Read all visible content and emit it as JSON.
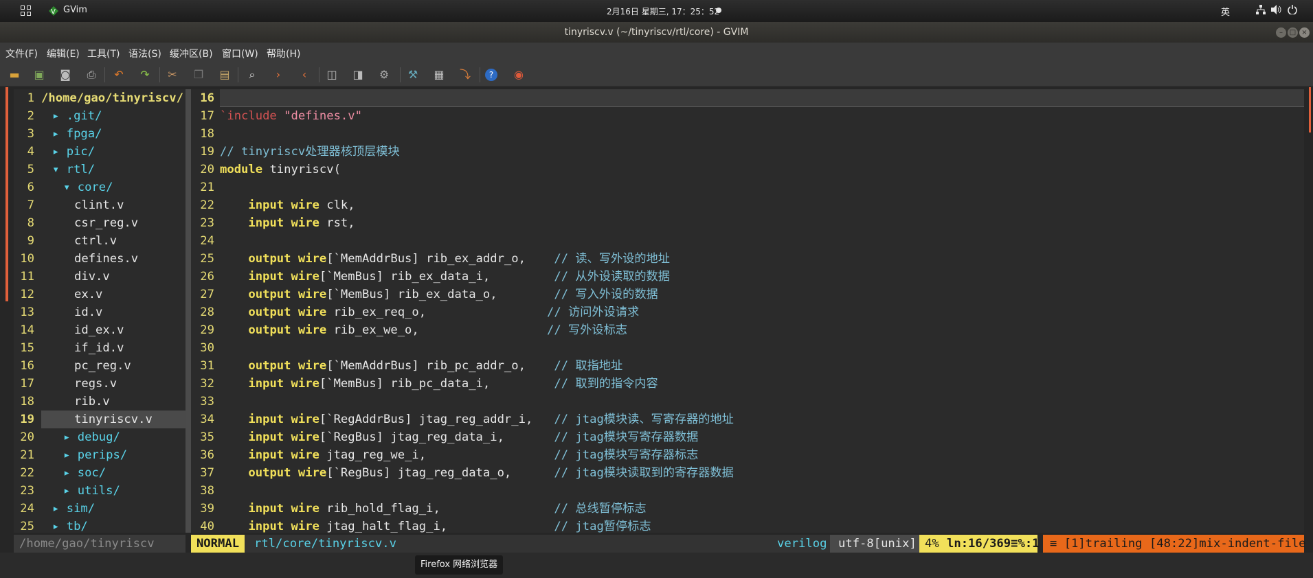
{
  "topbar": {
    "app_name": "GVim",
    "clock": "2月16日 星期三, 17：25：52",
    "ime": "英",
    "icons": [
      "network-icon",
      "volume-icon",
      "power-icon"
    ]
  },
  "window": {
    "title": "tinyriscv.v (~/tinyriscv/rtl/core) - GVIM"
  },
  "menu": [
    "文件(F)",
    "编辑(E)",
    "工具(T)",
    "语法(S)",
    "缓冲区(B)",
    "窗口(W)",
    "帮助(H)"
  ],
  "toolbar": [
    "open-icon",
    "save-session-icon",
    "save-icon",
    "print-icon",
    "undo-icon",
    "redo-icon",
    "cut-icon",
    "copy-icon",
    "paste-icon",
    "find-replace-icon",
    "find-next-icon",
    "find-prev-icon",
    "load-session-icon",
    "save-session-icon",
    "run-script-icon",
    "make-icon",
    "shell-icon",
    "tags-icon",
    "help-icon",
    "find-help-icon"
  ],
  "tree": {
    "current_line": 19,
    "rows": [
      {
        "n": "1",
        "text": "/home/gao/tinyriscv/",
        "kind": "root",
        "indent": 0,
        "arrow": ""
      },
      {
        "n": "2",
        "text": ".git/",
        "kind": "dir",
        "indent": 0,
        "arrow": "▸"
      },
      {
        "n": "3",
        "text": "fpga/",
        "kind": "dir",
        "indent": 0,
        "arrow": "▸"
      },
      {
        "n": "4",
        "text": "pic/",
        "kind": "dir",
        "indent": 0,
        "arrow": "▸"
      },
      {
        "n": "5",
        "text": "rtl/",
        "kind": "dir",
        "indent": 0,
        "arrow": "▾"
      },
      {
        "n": "6",
        "text": "core/",
        "kind": "dir",
        "indent": 1,
        "arrow": "▾"
      },
      {
        "n": "7",
        "text": "clint.v",
        "kind": "file",
        "indent": 2,
        "arrow": ""
      },
      {
        "n": "8",
        "text": "csr_reg.v",
        "kind": "file",
        "indent": 2,
        "arrow": ""
      },
      {
        "n": "9",
        "text": "ctrl.v",
        "kind": "file",
        "indent": 2,
        "arrow": ""
      },
      {
        "n": "10",
        "text": "defines.v",
        "kind": "file",
        "indent": 2,
        "arrow": ""
      },
      {
        "n": "11",
        "text": "div.v",
        "kind": "file",
        "indent": 2,
        "arrow": ""
      },
      {
        "n": "12",
        "text": "ex.v",
        "kind": "file",
        "indent": 2,
        "arrow": ""
      },
      {
        "n": "13",
        "text": "id.v",
        "kind": "file",
        "indent": 2,
        "arrow": ""
      },
      {
        "n": "14",
        "text": "id_ex.v",
        "kind": "file",
        "indent": 2,
        "arrow": ""
      },
      {
        "n": "15",
        "text": "if_id.v",
        "kind": "file",
        "indent": 2,
        "arrow": ""
      },
      {
        "n": "16",
        "text": "pc_reg.v",
        "kind": "file",
        "indent": 2,
        "arrow": ""
      },
      {
        "n": "17",
        "text": "regs.v",
        "kind": "file",
        "indent": 2,
        "arrow": ""
      },
      {
        "n": "18",
        "text": "rib.v",
        "kind": "file",
        "indent": 2,
        "arrow": ""
      },
      {
        "n": "19",
        "text": "tinyriscv.v",
        "kind": "file",
        "indent": 2,
        "arrow": ""
      },
      {
        "n": "20",
        "text": "debug/",
        "kind": "dir",
        "indent": 1,
        "arrow": "▸"
      },
      {
        "n": "21",
        "text": "perips/",
        "kind": "dir",
        "indent": 1,
        "arrow": "▸"
      },
      {
        "n": "22",
        "text": "soc/",
        "kind": "dir",
        "indent": 1,
        "arrow": "▸"
      },
      {
        "n": "23",
        "text": "utils/",
        "kind": "dir",
        "indent": 1,
        "arrow": "▸"
      },
      {
        "n": "24",
        "text": "sim/",
        "kind": "dir",
        "indent": 0,
        "arrow": "▸"
      },
      {
        "n": "25",
        "text": "tb/",
        "kind": "dir",
        "indent": 0,
        "arrow": "▸"
      }
    ]
  },
  "code": {
    "current_line": 16,
    "lines": [
      {
        "n": "16",
        "segs": []
      },
      {
        "n": "17",
        "segs": [
          [
            "dir",
            "`include "
          ],
          [
            "str",
            "\"defines.v\""
          ]
        ]
      },
      {
        "n": "18",
        "segs": []
      },
      {
        "n": "19",
        "segs": [
          [
            "cmt",
            "// tinyriscv处理器核顶层模块"
          ]
        ]
      },
      {
        "n": "20",
        "segs": [
          [
            "key",
            "module"
          ],
          [
            "plain",
            " tinyriscv("
          ]
        ]
      },
      {
        "n": "21",
        "segs": []
      },
      {
        "n": "22",
        "segs": [
          [
            "plain",
            "    "
          ],
          [
            "key",
            "input wire"
          ],
          [
            "plain",
            " clk,"
          ]
        ]
      },
      {
        "n": "23",
        "segs": [
          [
            "plain",
            "    "
          ],
          [
            "key",
            "input wire"
          ],
          [
            "plain",
            " rst,"
          ]
        ]
      },
      {
        "n": "24",
        "segs": []
      },
      {
        "n": "25",
        "segs": [
          [
            "plain",
            "    "
          ],
          [
            "key",
            "output wire"
          ],
          [
            "plain",
            "[`MemAddrBus] rib_ex_addr_o,    "
          ],
          [
            "cmt",
            "// 读、写外设的地址"
          ]
        ]
      },
      {
        "n": "26",
        "segs": [
          [
            "plain",
            "    "
          ],
          [
            "key",
            "input wire"
          ],
          [
            "plain",
            "[`MemBus] rib_ex_data_i,         "
          ],
          [
            "cmt",
            "// 从外设读取的数据"
          ]
        ]
      },
      {
        "n": "27",
        "segs": [
          [
            "plain",
            "    "
          ],
          [
            "key",
            "output wire"
          ],
          [
            "plain",
            "[`MemBus] rib_ex_data_o,        "
          ],
          [
            "cmt",
            "// 写入外设的数据"
          ]
        ]
      },
      {
        "n": "28",
        "segs": [
          [
            "plain",
            "    "
          ],
          [
            "key",
            "output wire"
          ],
          [
            "plain",
            " rib_ex_req_o,                 "
          ],
          [
            "cmt",
            "// 访问外设请求"
          ]
        ]
      },
      {
        "n": "29",
        "segs": [
          [
            "plain",
            "    "
          ],
          [
            "key",
            "output wire"
          ],
          [
            "plain",
            " rib_ex_we_o,                  "
          ],
          [
            "cmt",
            "// 写外设标志"
          ]
        ]
      },
      {
        "n": "30",
        "segs": []
      },
      {
        "n": "31",
        "segs": [
          [
            "plain",
            "    "
          ],
          [
            "key",
            "output wire"
          ],
          [
            "plain",
            "[`MemAddrBus] rib_pc_addr_o,    "
          ],
          [
            "cmt",
            "// 取指地址"
          ]
        ]
      },
      {
        "n": "32",
        "segs": [
          [
            "plain",
            "    "
          ],
          [
            "key",
            "input wire"
          ],
          [
            "plain",
            "[`MemBus] rib_pc_data_i,         "
          ],
          [
            "cmt",
            "// 取到的指令内容"
          ]
        ]
      },
      {
        "n": "33",
        "segs": []
      },
      {
        "n": "34",
        "segs": [
          [
            "plain",
            "    "
          ],
          [
            "key",
            "input wire"
          ],
          [
            "plain",
            "[`RegAddrBus] jtag_reg_addr_i,   "
          ],
          [
            "cmt",
            "// jtag模块读、写寄存器的地址"
          ]
        ]
      },
      {
        "n": "35",
        "segs": [
          [
            "plain",
            "    "
          ],
          [
            "key",
            "input wire"
          ],
          [
            "plain",
            "[`RegBus] jtag_reg_data_i,       "
          ],
          [
            "cmt",
            "// jtag模块写寄存器数据"
          ]
        ]
      },
      {
        "n": "36",
        "segs": [
          [
            "plain",
            "    "
          ],
          [
            "key",
            "input wire"
          ],
          [
            "plain",
            " jtag_reg_we_i,                  "
          ],
          [
            "cmt",
            "// jtag模块写寄存器标志"
          ]
        ]
      },
      {
        "n": "37",
        "segs": [
          [
            "plain",
            "    "
          ],
          [
            "key",
            "output wire"
          ],
          [
            "plain",
            "[`RegBus] jtag_reg_data_o,      "
          ],
          [
            "cmt",
            "// jtag模块读取到的寄存器数据"
          ]
        ]
      },
      {
        "n": "38",
        "segs": []
      },
      {
        "n": "39",
        "segs": [
          [
            "plain",
            "    "
          ],
          [
            "key",
            "input wire"
          ],
          [
            "plain",
            " rib_hold_flag_i,                "
          ],
          [
            "cmt",
            "// 总线暂停标志"
          ]
        ]
      },
      {
        "n": "40",
        "segs": [
          [
            "plain",
            "    "
          ],
          [
            "key",
            "input wire"
          ],
          [
            "plain",
            " jtag_halt_flag_i,               "
          ],
          [
            "cmt",
            "// jtag暂停标志"
          ]
        ]
      }
    ]
  },
  "statusline": {
    "tree_path": "/home/gao/tinyriscv",
    "mode": "NORMAL",
    "file": "rtl/core/tinyriscv.v",
    "filetype": "verilog",
    "encoding": "utf-8[unix]",
    "percent": "4%",
    "position": "ln:16/369≡%:1",
    "warnings": "≡ [1]trailing [48:22]mix-indent-file"
  },
  "tooltip": "Firefox 网络浏览器",
  "colors": {
    "mode_bg": "#f1e05a",
    "warn_bg": "#e8681a",
    "keyword": "#f1e05a",
    "comment": "#7fbfd6",
    "string": "#ef8ea4",
    "directive": "#d25252",
    "dir": "#59d2e8",
    "line_number": "#e6db74"
  }
}
